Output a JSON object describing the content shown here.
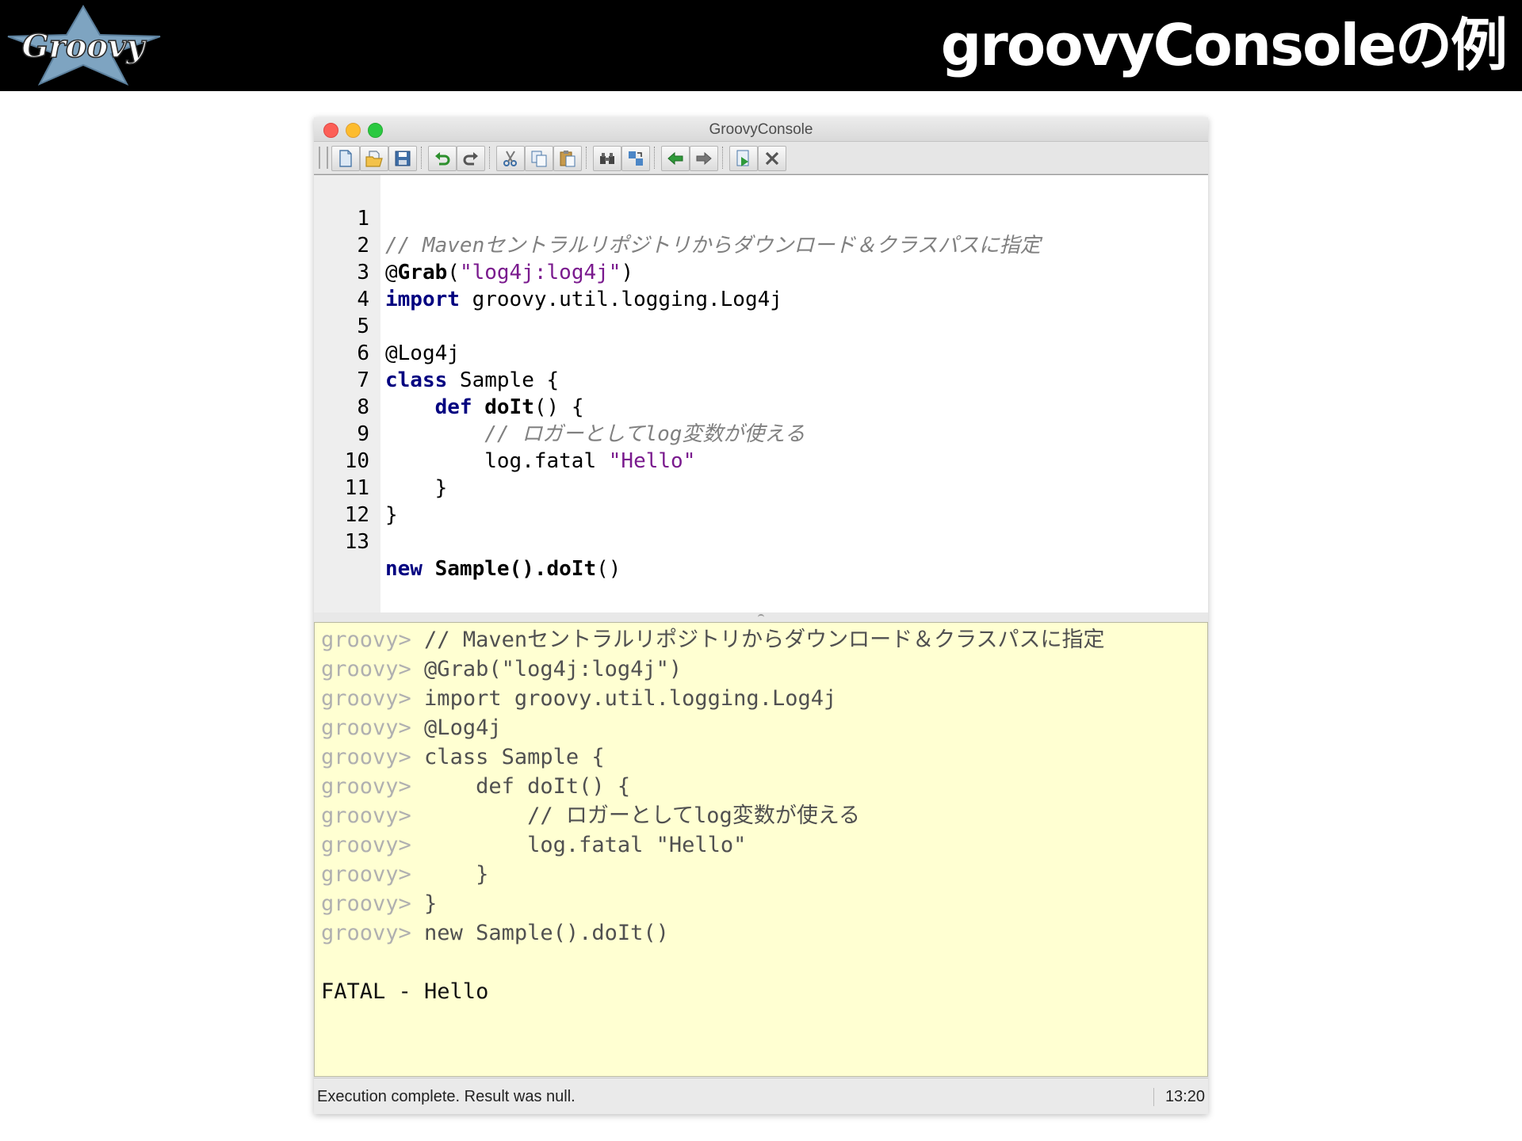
{
  "slide": {
    "title": "groovyConsoleの例",
    "logo_text": "Groovy"
  },
  "window": {
    "title": "GroovyConsole"
  },
  "toolbar": {
    "buttons": [
      {
        "icon": "new-file-icon"
      },
      {
        "icon": "open-folder-icon"
      },
      {
        "icon": "save-icon"
      },
      {
        "icon": "undo-icon"
      },
      {
        "icon": "redo-icon"
      },
      {
        "icon": "cut-icon"
      },
      {
        "icon": "copy-icon"
      },
      {
        "icon": "paste-icon"
      },
      {
        "icon": "find-icon"
      },
      {
        "icon": "replace-icon"
      },
      {
        "icon": "history-previous-icon"
      },
      {
        "icon": "history-next-icon"
      },
      {
        "icon": "run-script-icon"
      },
      {
        "icon": "interrupt-icon"
      }
    ]
  },
  "editor": {
    "line_numbers": [
      "1",
      "2",
      "3",
      "4",
      "5",
      "6",
      "7",
      "8",
      "9",
      "10",
      "11",
      "12",
      "13"
    ],
    "lines": [
      {
        "comment": "// Mavenセントラルリポジトリからダウンロード＆クラスパスに指定"
      },
      {
        "anno": "@",
        "anno_name": "Grab",
        "open": "(",
        "str": "\"log4j:log4j\"",
        "close": ")"
      },
      {
        "kw": "import",
        "rest": " groovy.util.logging.Log4j"
      },
      {},
      {
        "text": "@Log4j"
      },
      {
        "kw": "class",
        "rest": " Sample {"
      },
      {
        "indent": "    ",
        "kw": "def",
        "sp": " ",
        "name": "doIt",
        "rest": "() {"
      },
      {
        "indent": "        ",
        "comment": "// ロガーとしてlog変数が使える"
      },
      {
        "indent": "        ",
        "text": "log.fatal ",
        "str": "\"Hello\""
      },
      {
        "text": "    }"
      },
      {
        "text": "}"
      },
      {},
      {
        "kw": "new",
        "sp": " ",
        "name": "Sample().doIt",
        "rest": "()"
      }
    ]
  },
  "output": {
    "prompt": "groovy>",
    "lines": [
      " // Mavenセントラルリポジトリからダウンロード＆クラスパスに指定",
      " @Grab(\"log4j:log4j\")",
      " import groovy.util.logging.Log4j",
      " @Log4j",
      " class Sample {",
      "     def doIt() {",
      "         // ロガーとしてlog変数が使える",
      "         log.fatal \"Hello\"",
      "     }",
      " }",
      " new Sample().doIt()"
    ],
    "result": "FATAL - Hello"
  },
  "status": {
    "message": "Execution complete. Result was null.",
    "position": "13:20"
  },
  "colors": {
    "header_bg": "#000000",
    "output_bg": "#ffffd2",
    "keyword": "#000080",
    "string": "#7a1a8e",
    "comment": "#808080"
  }
}
